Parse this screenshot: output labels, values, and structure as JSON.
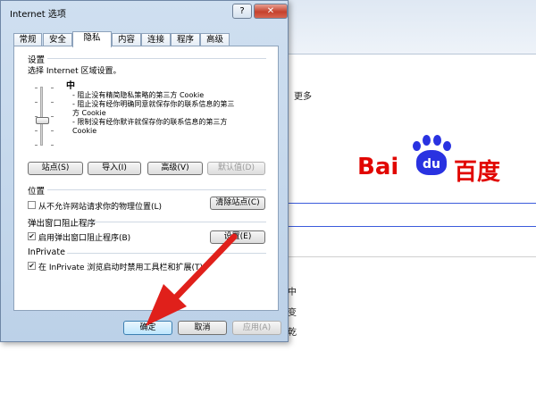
{
  "dialog": {
    "title": "Internet 选项",
    "help_label": "?",
    "close_label": "✕",
    "tabs": [
      {
        "label": "常规"
      },
      {
        "label": "安全"
      },
      {
        "label": "隐私"
      },
      {
        "label": "内容"
      },
      {
        "label": "连接"
      },
      {
        "label": "程序"
      },
      {
        "label": "高级"
      }
    ],
    "active_tab": "隐私",
    "settings": {
      "heading": "设置",
      "zone_prompt": "选择 Internet 区域设置。",
      "level": "中",
      "level_position": 0.5,
      "desc_lines": [
        "- 阻止没有精简隐私策略的第三方 Cookie",
        "- 阻止没有经你明确同意就保存你的联系信息的第三",
        "方 Cookie",
        "- 限制没有经你默许就保存你的联系信息的第三方",
        "Cookie"
      ],
      "buttons": {
        "sites": "站点(S)",
        "import": "导入(I)",
        "advanced": "高级(V)",
        "default": "默认值(D)"
      }
    },
    "location": {
      "heading": "位置",
      "checkbox_label": "从不允许网站请求你的物理位置(L)",
      "checked": false,
      "clear_button": "清除站点(C)"
    },
    "popup": {
      "heading": "弹出窗口阻止程序",
      "checkbox_label": "启用弹出窗口阻止程序(B)",
      "checked": true,
      "settings_button": "设置(E)"
    },
    "inprivate": {
      "heading": "InPrivate",
      "checkbox_label": "在 InPrivate 浏览启动时禁用工具栏和扩展(T)",
      "checked": true
    },
    "footer": {
      "ok": "确定",
      "cancel": "取消",
      "apply": "应用(A)"
    }
  },
  "background": {
    "more_link": "更多",
    "side_chars": [
      "中",
      "变",
      "乾"
    ],
    "logo": {
      "part1": "Bai",
      "part2": "百度",
      "paw_text": "du"
    }
  },
  "colors": {
    "logo_red": "#e10601",
    "logo_blue": "#2932e1",
    "arrow_red": "#e0201b"
  }
}
